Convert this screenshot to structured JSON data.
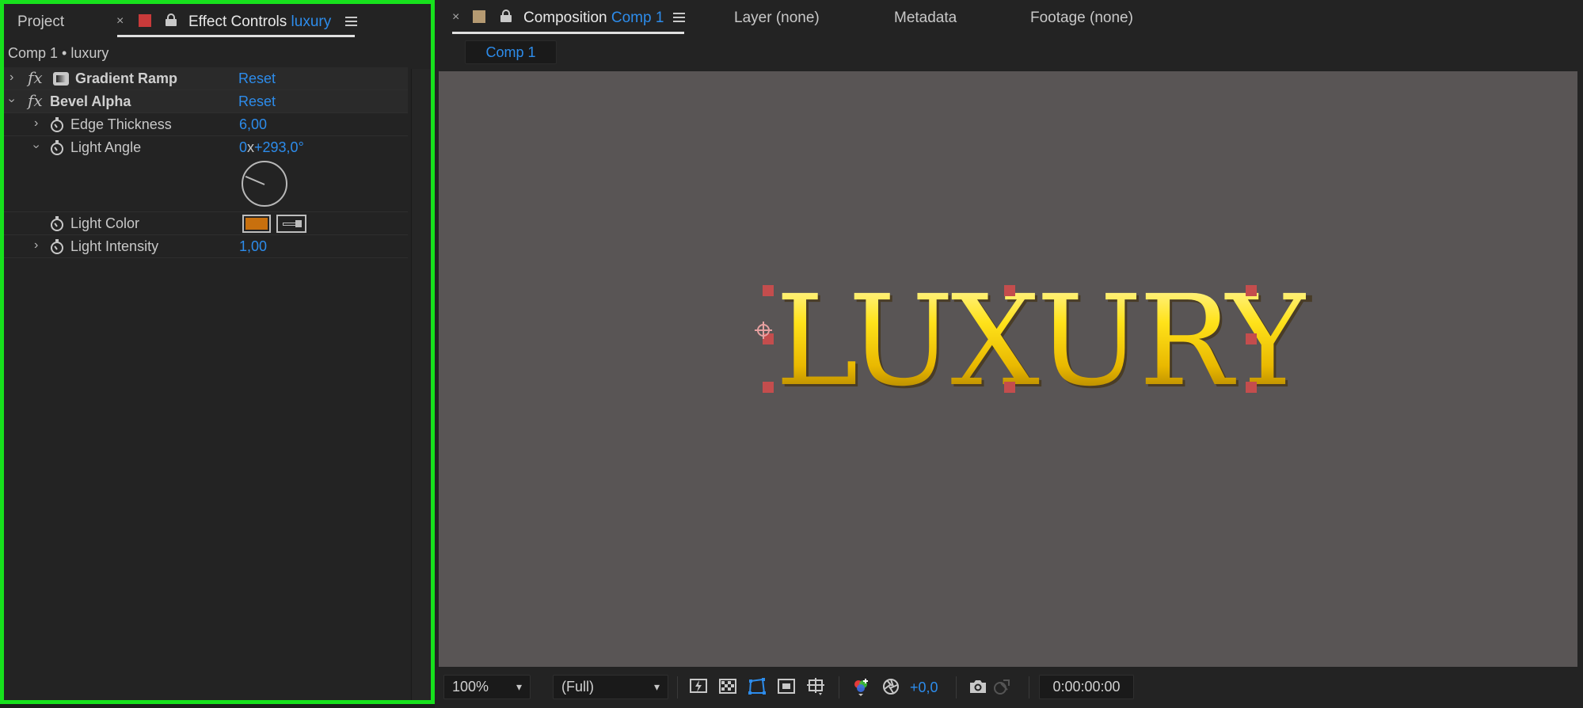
{
  "left_panel": {
    "tabs": {
      "project": "Project",
      "effect_controls_label": "Effect Controls",
      "effect_controls_layer": "luxury",
      "label_color": "#c83a3a"
    },
    "breadcrumb": "Comp 1 • luxury",
    "effects": {
      "gradient_ramp": {
        "name": "Gradient Ramp",
        "reset": "Reset"
      },
      "bevel_alpha": {
        "name": "Bevel Alpha",
        "reset": "Reset",
        "edge_thickness": {
          "label": "Edge Thickness",
          "value": "6,00"
        },
        "light_angle": {
          "label": "Light Angle",
          "value_prefix": "0",
          "value_x": "x",
          "value_deg": "+293,0°",
          "angle_degrees": 293
        },
        "light_color": {
          "label": "Light Color",
          "color": "#c8700e"
        },
        "light_intensity": {
          "label": "Light Intensity",
          "value": "1,00"
        }
      }
    }
  },
  "right_panel": {
    "tabs": {
      "composition_label": "Composition",
      "composition_name": "Comp 1",
      "composition_color": "#b59a72",
      "layer_label": "Layer",
      "layer_value": "(none)",
      "metadata": "Metadata",
      "footage_label": "Footage",
      "footage_value": "(none)"
    },
    "subtab": "Comp 1",
    "viewer": {
      "text": "LUXURY",
      "background": "#595555"
    },
    "toolbar": {
      "zoom": "100%",
      "resolution": "(Full)",
      "exposure": "+0,0",
      "timecode": "0:00:00:00"
    }
  },
  "icons": [
    "close-icon",
    "lock-icon",
    "panel-menu-icon",
    "fx-icon",
    "gradient-ramp-icon",
    "stopwatch-icon",
    "eyedropper-icon",
    "fast-preview-icon",
    "transparency-grid-icon",
    "mask-path-icon",
    "region-of-interest-icon",
    "guides-icon",
    "color-channels-icon",
    "reset-exposure-icon",
    "snapshot-icon",
    "show-snapshot-icon",
    "chevron-down-icon",
    "chevron-right-icon"
  ]
}
